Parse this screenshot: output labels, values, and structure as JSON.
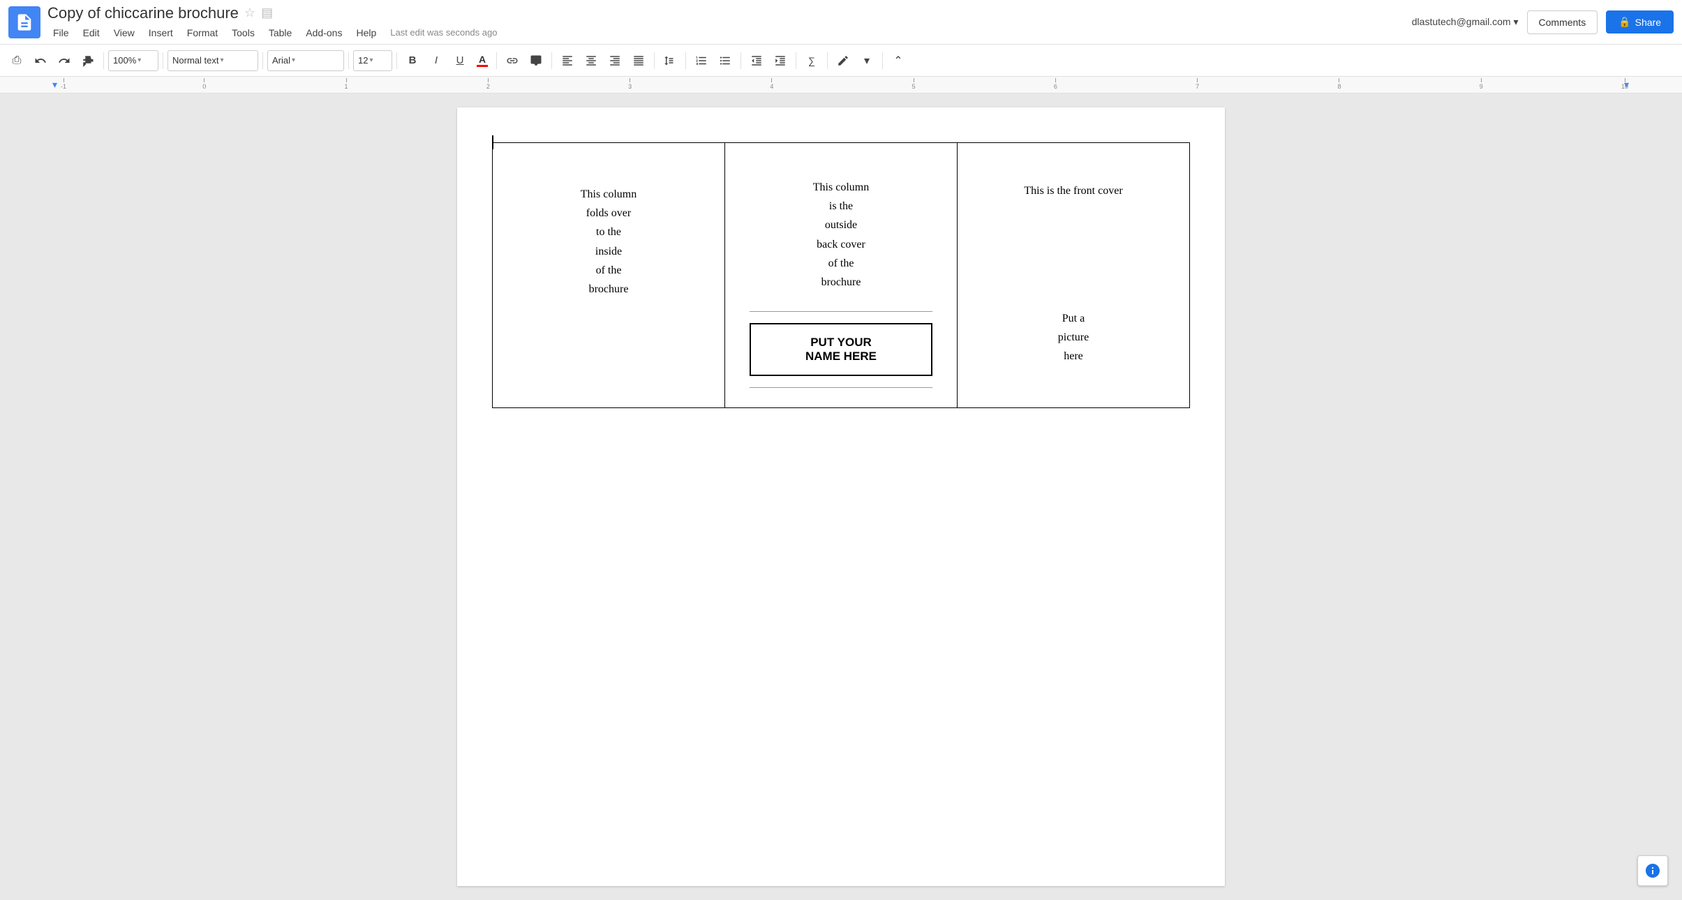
{
  "app": {
    "icon_color": "#4285f4",
    "title": "Copy of chiccarine brochure",
    "star_icon": "☆",
    "folder_icon": "▤",
    "last_edit": "Last edit was seconds ago",
    "user_email": "dlastutech@gmail.com"
  },
  "menu": {
    "file": "File",
    "edit": "Edit",
    "view": "View",
    "insert": "Insert",
    "format": "Format",
    "tools": "Tools",
    "table": "Table",
    "addons": "Add-ons",
    "help": "Help"
  },
  "header_buttons": {
    "comments": "Comments",
    "share": "Share",
    "share_icon": "🔒"
  },
  "toolbar": {
    "print": "⎙",
    "undo": "↩",
    "redo": "↪",
    "paint": "🖌",
    "zoom": "100%",
    "style": "Normal text",
    "font": "Arial",
    "size": "12",
    "bold": "B",
    "italic": "I",
    "underline": "U",
    "text_color_label": "A",
    "link": "🔗",
    "comment": "💬",
    "align_left": "≡",
    "align_center": "≡",
    "align_right": "≡",
    "align_justify": "≡",
    "line_spacing": "↕",
    "numbered_list": "1.",
    "bullet_list": "•",
    "outdent": "⇤",
    "indent": "⇥",
    "formula": "∑",
    "pen": "✏",
    "collapse": "⌃"
  },
  "ruler": {
    "ticks": [
      "-1",
      "0",
      "1",
      "2",
      "3",
      "4",
      "5",
      "6",
      "7",
      "8",
      "9",
      "10"
    ]
  },
  "brochure": {
    "col1_text": "This column\nfolds over\nto the\ninside\nof the\nbrochure",
    "col2_top_text": "This column\nis the\noutside\nback cover\nof the\nbrochure",
    "col2_name_box_line1": "PUT YOUR",
    "col2_name_box_line2": "NAME HERE",
    "col3_top_text": "This is the front cover",
    "col3_bottom_text": "Put a\npicture\nhere"
  }
}
